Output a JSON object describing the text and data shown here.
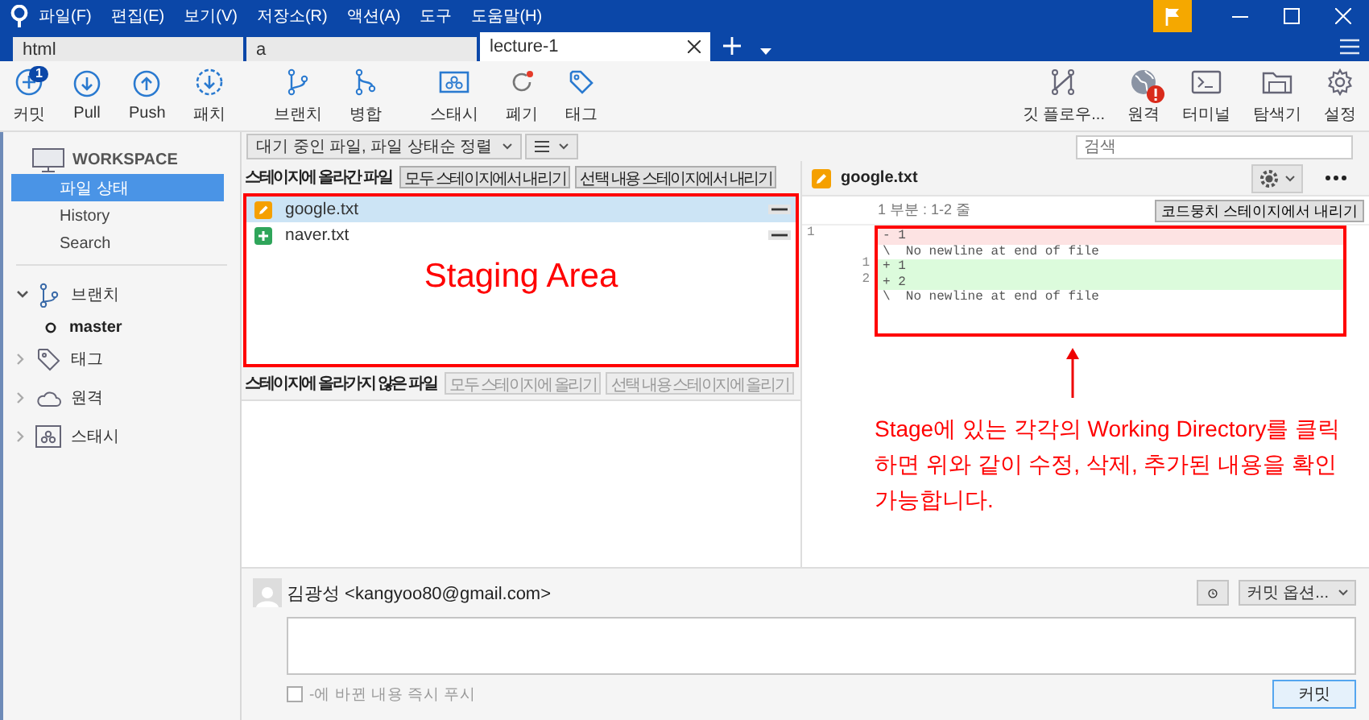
{
  "window": {
    "menu": [
      "파일(F)",
      "편집(E)",
      "보기(V)",
      "저장소(R)",
      "액션(A)",
      "도구",
      "도움말(H)"
    ]
  },
  "tabs": [
    {
      "label": "html",
      "selected": false
    },
    {
      "label": "a",
      "selected": false
    },
    {
      "label": "lecture-1",
      "selected": true
    }
  ],
  "toolbar": {
    "left": [
      {
        "label": "커밋",
        "badge": "1"
      },
      {
        "label": "Pull"
      },
      {
        "label": "Push"
      },
      {
        "label": "패치"
      },
      {
        "label": "브랜치"
      },
      {
        "label": "병합"
      },
      {
        "label": "스태시"
      },
      {
        "label": "폐기"
      },
      {
        "label": "태그"
      }
    ],
    "right": [
      {
        "label": "깃 플로우...",
        "alert": false
      },
      {
        "label": "원격",
        "alert": true
      },
      {
        "label": "터미널",
        "alert": false
      },
      {
        "label": "탐색기",
        "alert": false
      },
      {
        "label": "설정",
        "alert": false
      }
    ]
  },
  "sidebar": {
    "workspace": {
      "title": "WORKSPACE",
      "items": [
        {
          "label": "파일 상태",
          "selected": true
        },
        {
          "label": "History",
          "selected": false
        },
        {
          "label": "Search",
          "selected": false
        }
      ]
    },
    "sections": [
      {
        "label": "브랜치",
        "expanded": true,
        "children": [
          {
            "label": "master",
            "current": true
          }
        ]
      },
      {
        "label": "태그",
        "expanded": false
      },
      {
        "label": "원격",
        "expanded": false
      },
      {
        "label": "스태시",
        "expanded": false
      }
    ]
  },
  "filter": {
    "sort": "대기 중인 파일, 파일 상태순 정렬",
    "search_placeholder": "검색"
  },
  "staged": {
    "title": "스테이지에 올라간 파일",
    "buttons": [
      {
        "label": "모두 스테이지에서 내리기",
        "disabled": false
      },
      {
        "label": "선택 내용 스테이지에서 내리기",
        "disabled": false
      }
    ],
    "files": [
      {
        "name": "google.txt",
        "kind": "modified",
        "selected": true
      },
      {
        "name": "naver.txt",
        "kind": "added",
        "selected": false
      }
    ]
  },
  "unstaged": {
    "title": "스테이지에 올라가지 않은 파일",
    "buttons": [
      {
        "label": "모두 스테이지에 올리기",
        "disabled": true
      },
      {
        "label": "선택 내용 스테이지에 올리기",
        "disabled": true
      }
    ]
  },
  "diff": {
    "file": "google.txt",
    "kind": "modified",
    "hunk": "1 부분 : 1-2 줄",
    "hunk_button": "코드뭉치 스테이지에서 내리기",
    "lines": [
      {
        "old": "1",
        "text": "- 1",
        "kind": "removed"
      },
      {
        "text": "\\  No newline at end of file",
        "kind": "context"
      },
      {
        "new": "1",
        "text": "+ 1",
        "kind": "added"
      },
      {
        "new": "2",
        "text": "+ 2",
        "kind": "added"
      },
      {
        "text": "\\  No newline at end of file",
        "kind": "context"
      }
    ]
  },
  "commit": {
    "author": "김광성 <kangyoo80@gmail.com>",
    "options": "커밋 옵션...",
    "push": {
      "label": "-에 바뀐 내용 즉시 푸시",
      "checked": false,
      "disabled": true
    },
    "button": "커밋"
  },
  "annotations": {
    "staging": "Staging Area",
    "note": "Stage에 있는 각각의 Working Directory를 클릭하면 위와 같이 수정, 삭제, 추가된 내용을 확인 가능합니다."
  }
}
